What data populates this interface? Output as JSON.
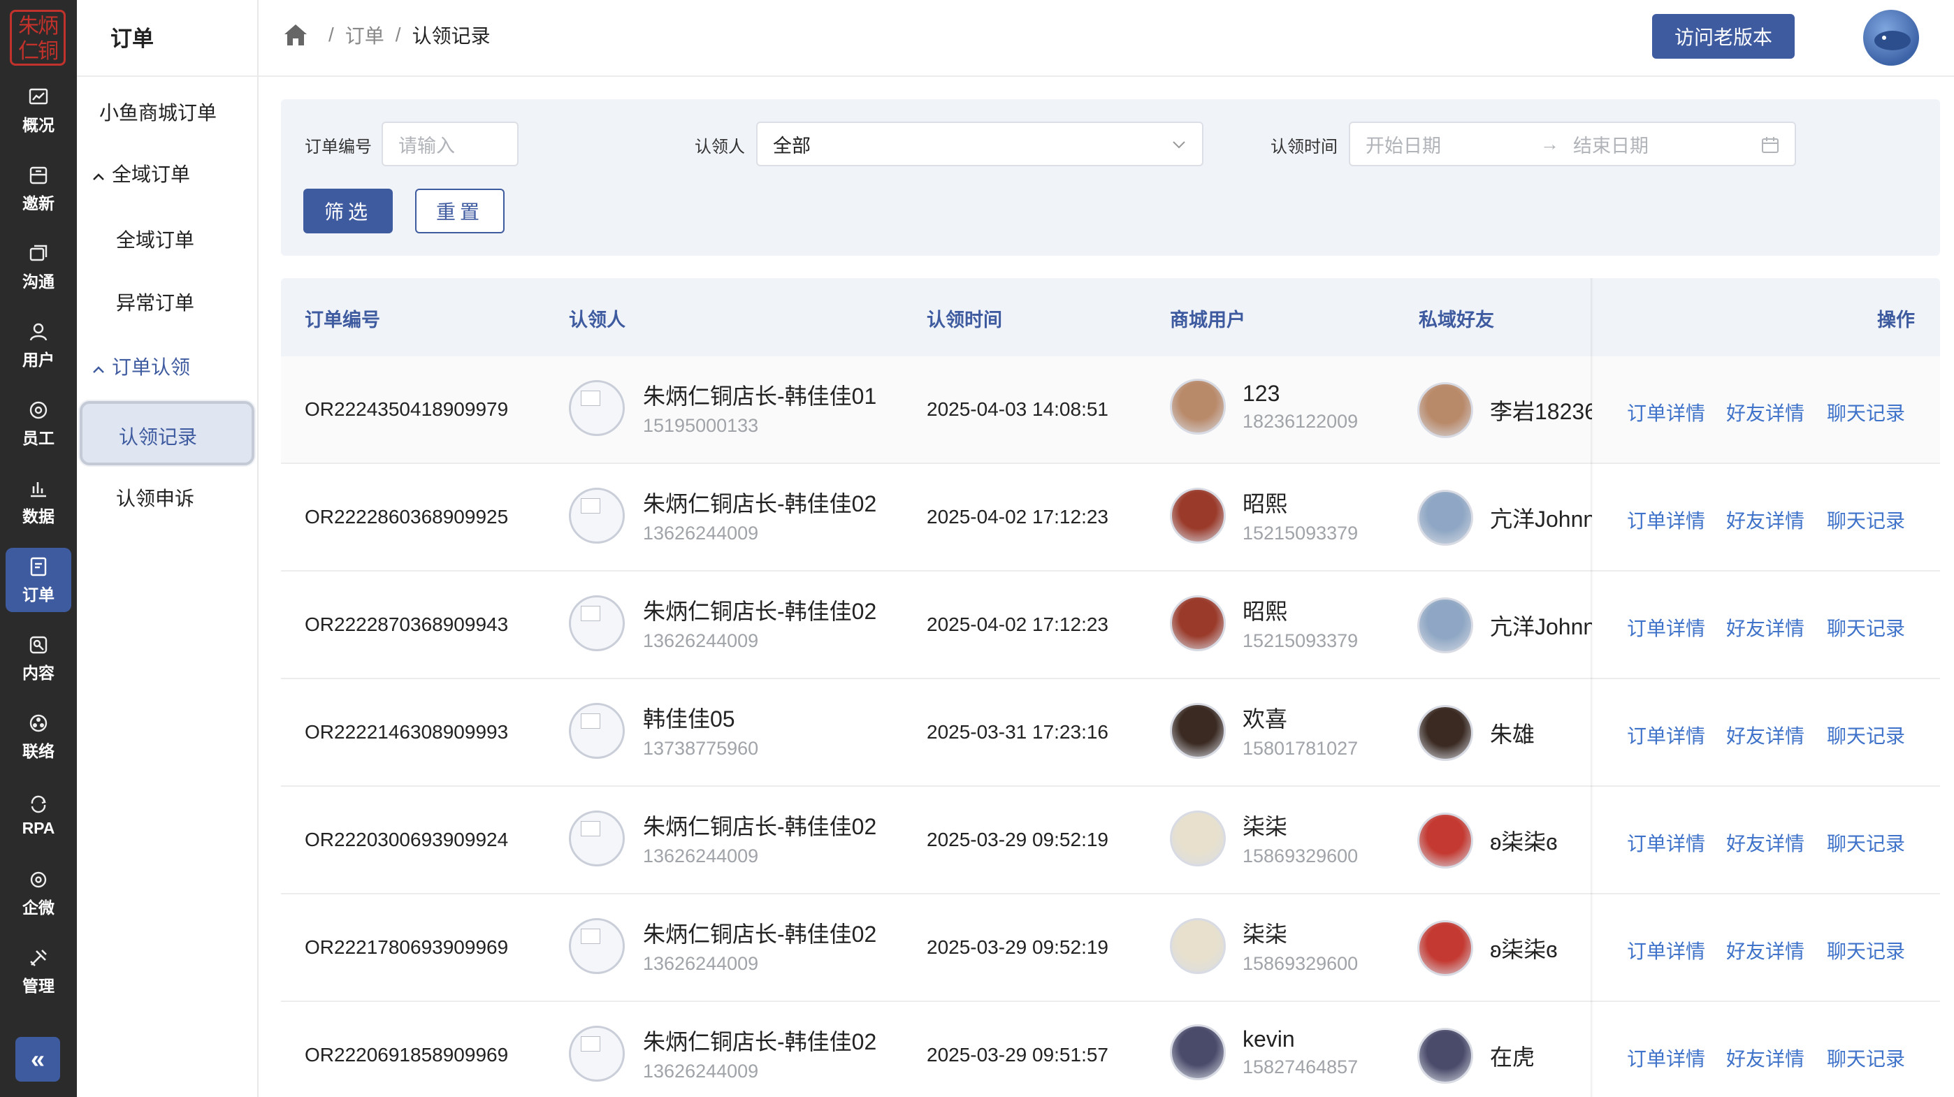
{
  "rail": {
    "logo_text": "朱炳仁铜",
    "items": [
      {
        "label": "概况",
        "icon": "chart-icon"
      },
      {
        "label": "邀新",
        "icon": "invite-icon"
      },
      {
        "label": "沟通",
        "icon": "chat-icon"
      },
      {
        "label": "用户",
        "icon": "user-icon"
      },
      {
        "label": "员工",
        "icon": "staff-icon"
      },
      {
        "label": "数据",
        "icon": "bar-chart-icon"
      },
      {
        "label": "订单",
        "icon": "order-icon",
        "active": true
      },
      {
        "label": "内容",
        "icon": "content-icon"
      },
      {
        "label": "联络",
        "icon": "connect-icon"
      },
      {
        "label": "RPA",
        "icon": "rpa-icon"
      },
      {
        "label": "企微",
        "icon": "wecom-icon"
      },
      {
        "label": "管理",
        "icon": "tools-icon"
      }
    ],
    "collapse_icon": "double-chevron-left-icon"
  },
  "subnav": {
    "title": "订单",
    "items": [
      {
        "label": "小鱼商城订单"
      },
      {
        "label": "全域订单",
        "group": true
      },
      {
        "label": "全域订单"
      },
      {
        "label": "异常订单"
      },
      {
        "label": "订单认领",
        "group": true,
        "open": true
      },
      {
        "label": "认领记录",
        "active": true
      },
      {
        "label": "认领申诉"
      }
    ]
  },
  "header": {
    "breadcrumb": [
      "订单",
      "认领记录"
    ],
    "old_version_button": "访问老版本"
  },
  "filter": {
    "order_no_label": "订单编号",
    "order_no_placeholder": "请输入",
    "claimer_label": "认领人",
    "claimer_value": "全部",
    "time_label": "认领时间",
    "start_placeholder": "开始日期",
    "end_placeholder": "结束日期",
    "filter_button": "筛选",
    "reset_button": "重置"
  },
  "table": {
    "columns": [
      "订单编号",
      "认领人",
      "认领时间",
      "商城用户",
      "私域好友",
      "操作"
    ],
    "actions": [
      "订单详情",
      "好友详情",
      "聊天记录"
    ],
    "rows": [
      {
        "order_no": "OR2224350418909979",
        "claimer": "朱炳仁铜店长-韩佳佳01",
        "claimer_phone": "15195000133",
        "time": "2025-04-03 14:08:51",
        "user": "123",
        "user_phone": "18236122009",
        "friend": "李岩18236",
        "user_color": "#b98a6a",
        "friend_color": "#b98a6a"
      },
      {
        "order_no": "OR2222860368909925",
        "claimer": "朱炳仁铜店长-韩佳佳02",
        "claimer_phone": "13626244009",
        "time": "2025-04-02 17:12:23",
        "user": "昭熙",
        "user_phone": "15215093379",
        "friend": "亢洋Johnn",
        "user_color": "#9a3a2a",
        "friend_color": "#8fa7c4"
      },
      {
        "order_no": "OR2222870368909943",
        "claimer": "朱炳仁铜店长-韩佳佳02",
        "claimer_phone": "13626244009",
        "time": "2025-04-02 17:12:23",
        "user": "昭熙",
        "user_phone": "15215093379",
        "friend": "亢洋Johnn",
        "user_color": "#9a3a2a",
        "friend_color": "#8fa7c4"
      },
      {
        "order_no": "OR2222146308909993",
        "claimer": "韩佳佳05",
        "claimer_phone": "13738775960",
        "time": "2025-03-31 17:23:16",
        "user": "欢喜",
        "user_phone": "15801781027",
        "friend": "朱雄",
        "user_color": "#3a2a22",
        "friend_color": "#3a2a22"
      },
      {
        "order_no": "OR2220300693909924",
        "claimer": "朱炳仁铜店长-韩佳佳02",
        "claimer_phone": "13626244009",
        "time": "2025-03-29 09:52:19",
        "user": "柒柒",
        "user_phone": "15869329600",
        "friend": "ʚ柒柒ɞ",
        "user_color": "#e8e0cc",
        "friend_color": "#c43a32"
      },
      {
        "order_no": "OR2221780693909969",
        "claimer": "朱炳仁铜店长-韩佳佳02",
        "claimer_phone": "13626244009",
        "time": "2025-03-29 09:52:19",
        "user": "柒柒",
        "user_phone": "15869329600",
        "friend": "ʚ柒柒ɞ",
        "user_color": "#e8e0cc",
        "friend_color": "#c43a32"
      },
      {
        "order_no": "OR2220691858909969",
        "claimer": "朱炳仁铜店长-韩佳佳02",
        "claimer_phone": "13626244009",
        "time": "2025-03-29 09:51:57",
        "user": "kevin",
        "user_phone": "15827464857",
        "friend": "在虎",
        "user_color": "#4a4a6a",
        "friend_color": "#4a4a6a"
      }
    ]
  }
}
